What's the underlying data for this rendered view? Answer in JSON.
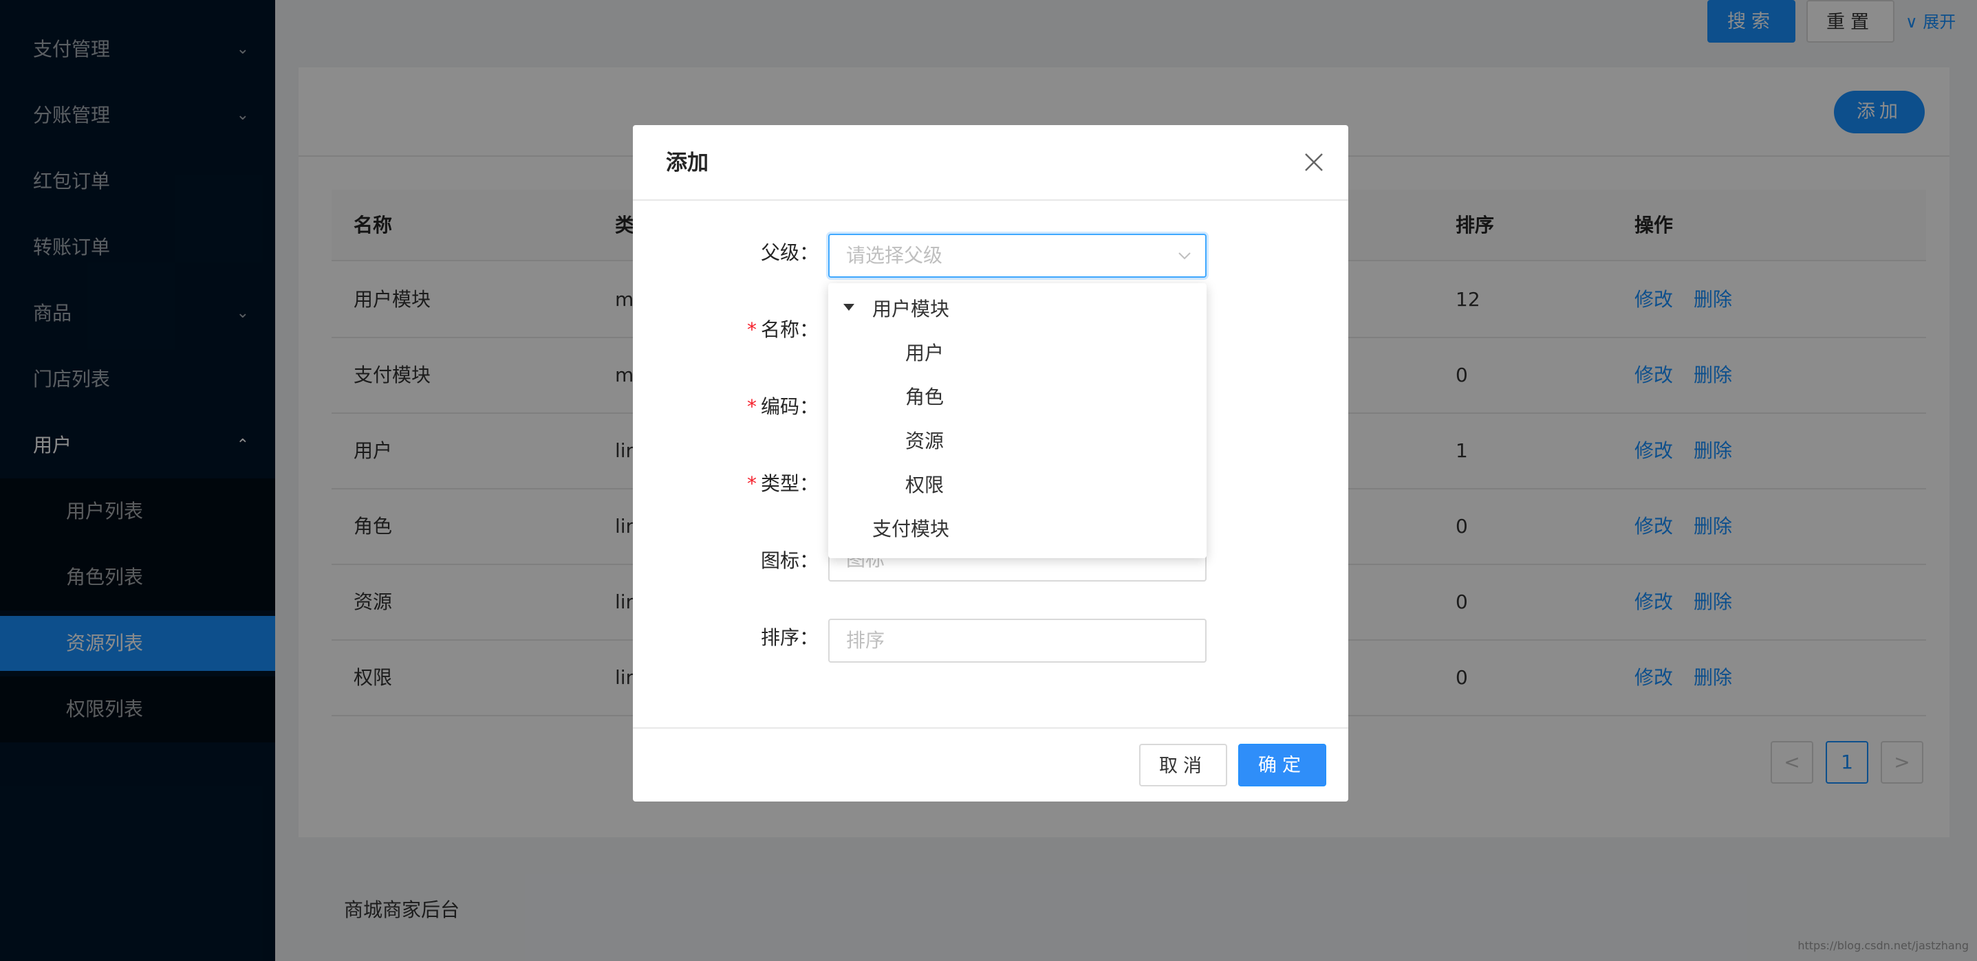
{
  "sidebar": {
    "items": [
      {
        "label": "支付管理",
        "arrow": "⌄"
      },
      {
        "label": "分账管理",
        "arrow": "⌄"
      },
      {
        "label": "红包订单"
      },
      {
        "label": "转账订单"
      },
      {
        "label": "商品",
        "arrow": "⌄"
      },
      {
        "label": "门店列表"
      },
      {
        "label": "用户",
        "arrow": "⌃"
      }
    ],
    "sub_items": [
      {
        "label": "用户列表"
      },
      {
        "label": "角色列表"
      },
      {
        "label": "资源列表"
      },
      {
        "label": "权限列表"
      }
    ]
  },
  "toolbar": {
    "search_label": "搜索",
    "reset_label": "重置",
    "expand_label": "展开",
    "expand_icon": "∨"
  },
  "card": {
    "add_label": "添加"
  },
  "table": {
    "headers": {
      "name": "名称",
      "type": "类",
      "sort": "排序",
      "action": "操作"
    },
    "rows": [
      {
        "name": "用户模块",
        "type": "m",
        "sort": "12"
      },
      {
        "name": "支付模块",
        "type": "m",
        "sort": "0"
      },
      {
        "name": "用户",
        "type": "lin",
        "sort": "1"
      },
      {
        "name": "角色",
        "type": "lin",
        "sort": "0"
      },
      {
        "name": "资源",
        "type": "lin",
        "sort": "0"
      },
      {
        "name": "权限",
        "type": "lin",
        "sort": "0"
      }
    ],
    "edit_label": "修改",
    "delete_label": "删除"
  },
  "pagination": {
    "prev": "<",
    "current": "1",
    "next": ">"
  },
  "footer": {
    "text": "商城商家后台"
  },
  "watermark": "https://blog.csdn.net/jastzhang",
  "modal": {
    "title": "添加",
    "fields": {
      "parent_label": "父级",
      "parent_placeholder": "请选择父级",
      "name_label": "名称",
      "code_label": "编码",
      "type_label": "类型",
      "icon_label": "图标",
      "icon_placeholder": "图标",
      "sort_label": "排序",
      "sort_placeholder": "排序"
    },
    "cancel_label": "取消",
    "ok_label": "确定"
  },
  "dropdown": {
    "tree": [
      {
        "label": "用户模块",
        "children": [
          "用户",
          "角色",
          "资源",
          "权限"
        ]
      },
      {
        "label": "支付模块"
      }
    ]
  },
  "colors": {
    "sidebar_bg": "#001529",
    "primary": "#1890ff",
    "required": "#f5222d"
  }
}
